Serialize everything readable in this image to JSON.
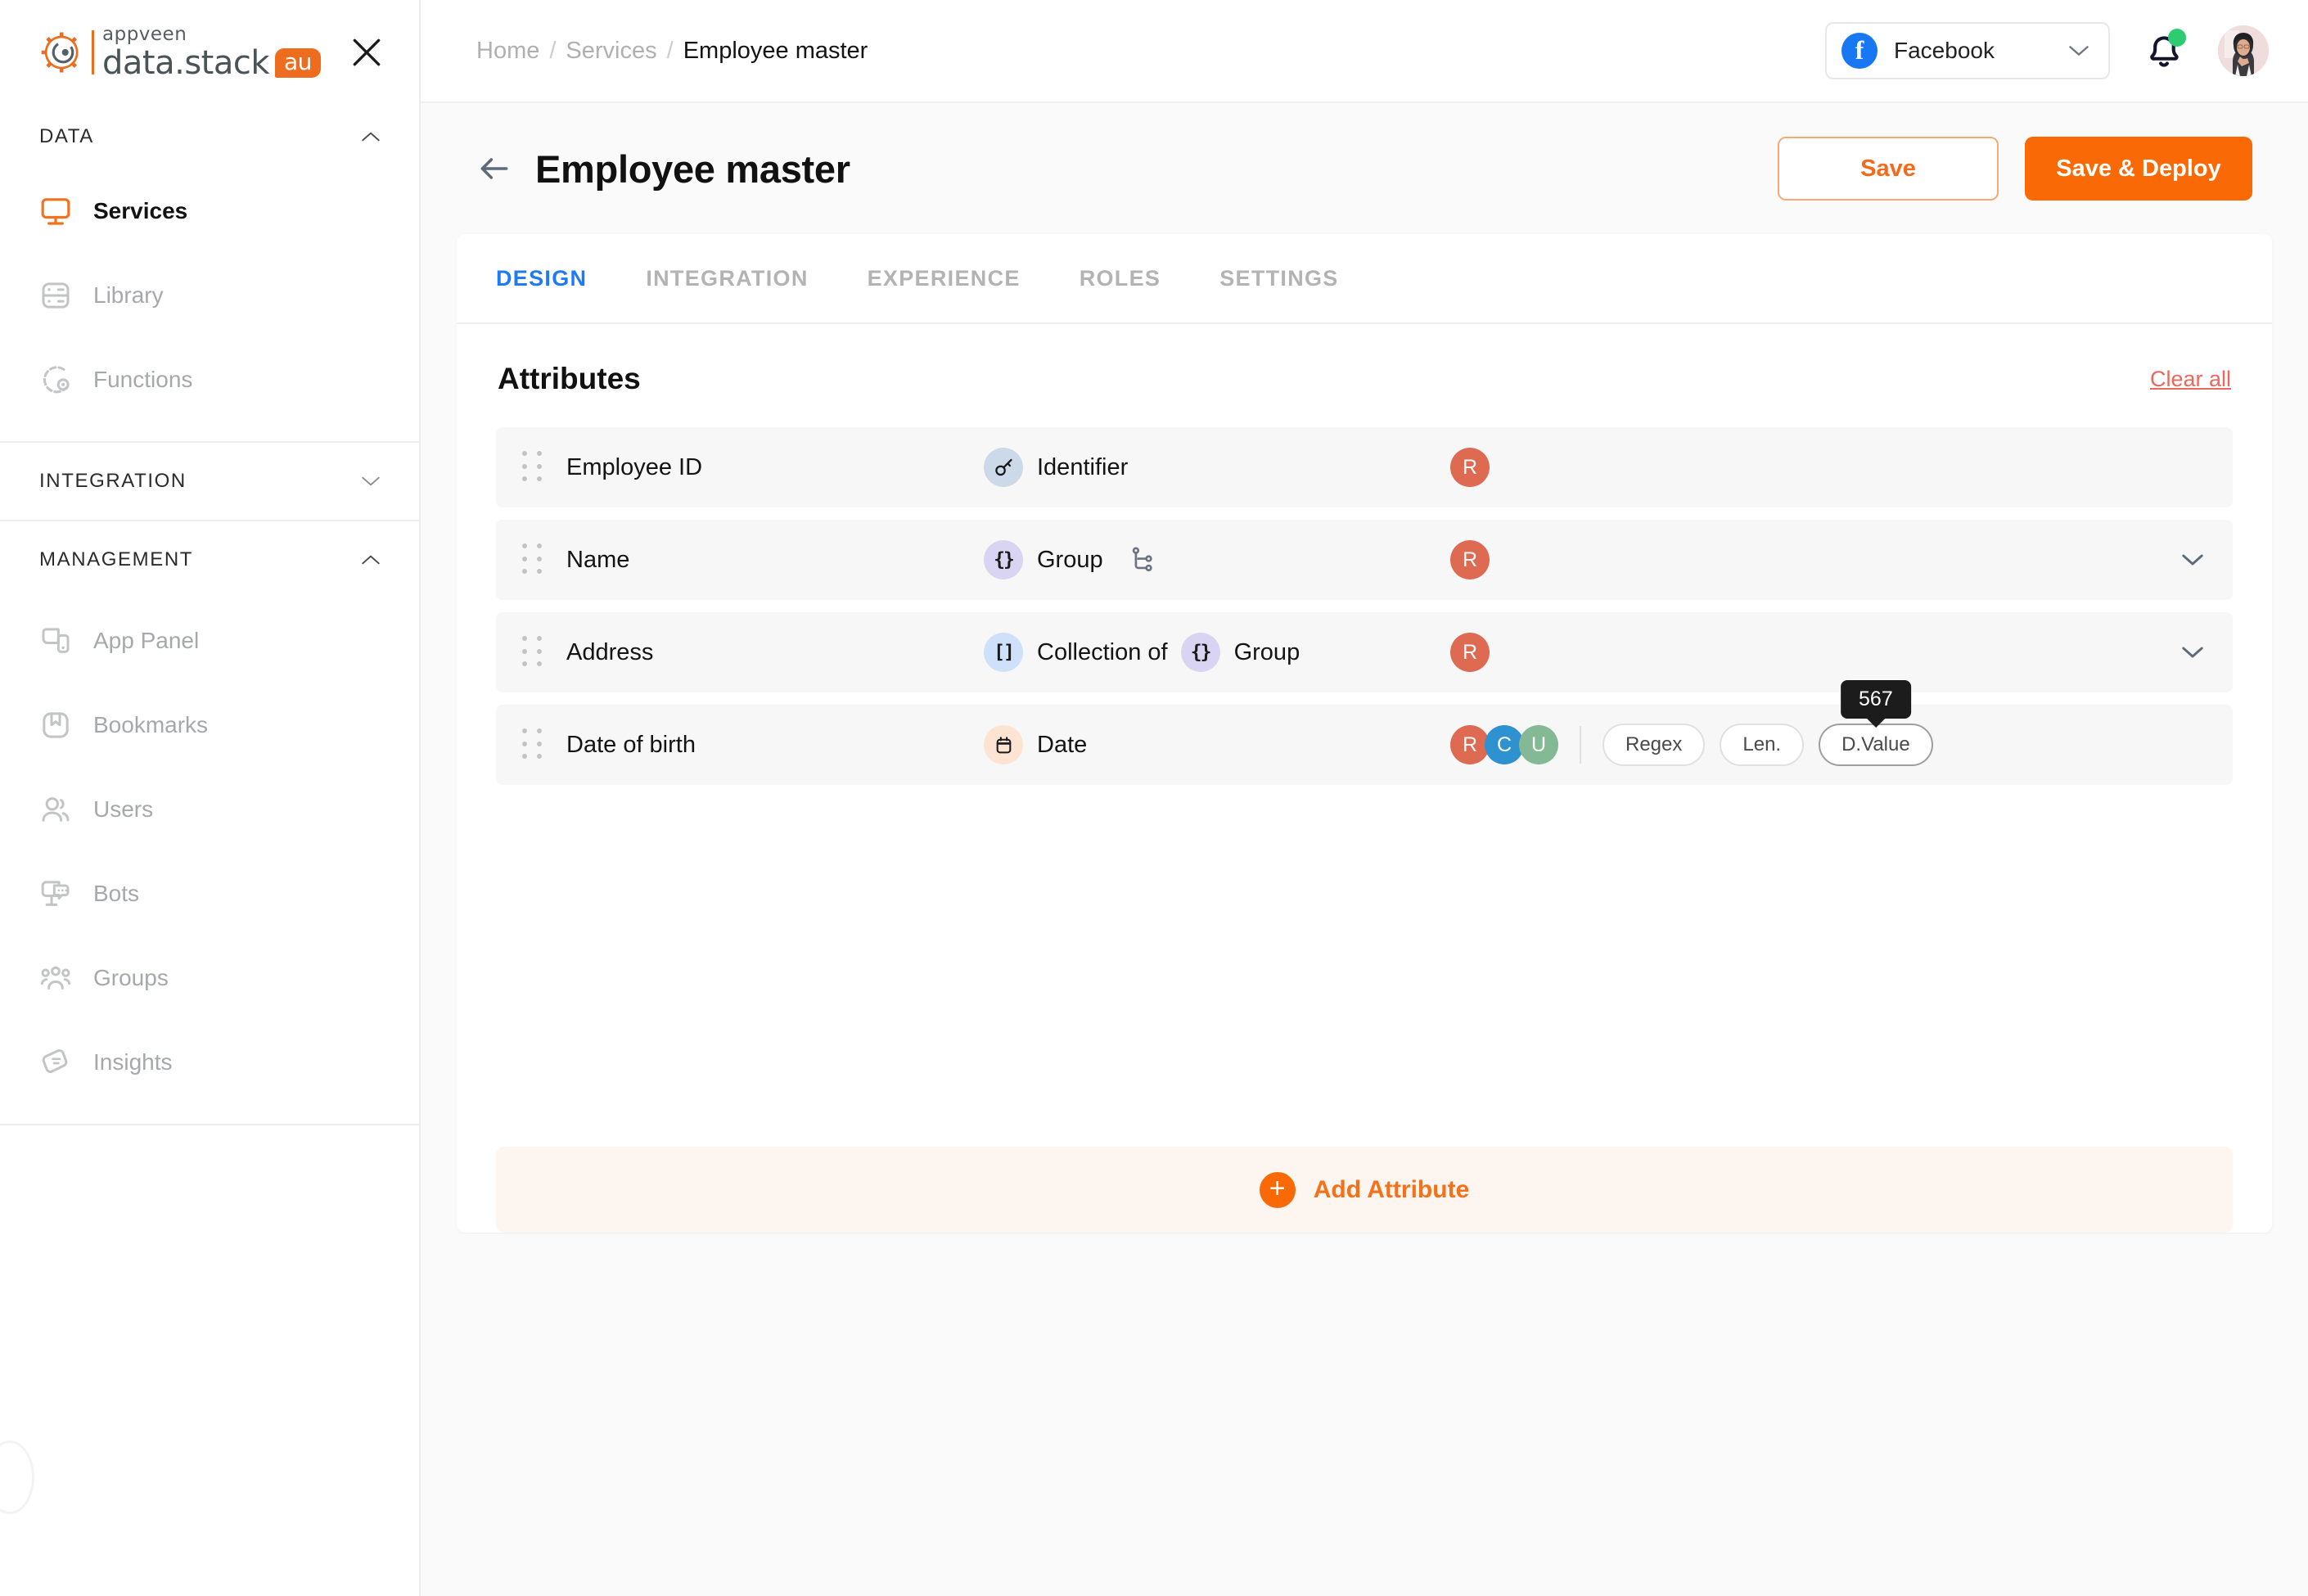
{
  "brand": {
    "appveen": "appveen",
    "product": "data.stack",
    "suffix": "au",
    "close_icon": "close-icon"
  },
  "sidebar": {
    "sections": [
      {
        "label": "DATA",
        "expanded": true,
        "chevron": "chevron-up-icon",
        "items": [
          {
            "label": "Services",
            "icon": "monitor-icon",
            "active": true
          },
          {
            "label": "Library",
            "icon": "library-icon",
            "active": false
          },
          {
            "label": "Functions",
            "icon": "chip-gear-icon",
            "active": false
          }
        ]
      },
      {
        "label": "INTEGRATION",
        "expanded": false,
        "chevron": "chevron-down-icon",
        "items": []
      },
      {
        "label": "MANAGEMENT",
        "expanded": true,
        "chevron": "chevron-up-icon",
        "items": [
          {
            "label": "App Panel",
            "icon": "app-panel-icon",
            "active": false
          },
          {
            "label": "Bookmarks",
            "icon": "bookmark-icon",
            "active": false
          },
          {
            "label": "Users",
            "icon": "users-icon",
            "active": false
          },
          {
            "label": "Bots",
            "icon": "bot-icon",
            "active": false
          },
          {
            "label": "Groups",
            "icon": "groups-icon",
            "active": false
          },
          {
            "label": "Insights",
            "icon": "insights-icon",
            "active": false
          }
        ]
      }
    ]
  },
  "topbar": {
    "breadcrumb": {
      "home": "Home",
      "services": "Services",
      "current": "Employee master",
      "separator": "/"
    },
    "app_selector": {
      "value": "Facebook",
      "icon": "facebook-icon",
      "chevron": "chevron-down-icon"
    },
    "notifications": {
      "icon": "bell-icon",
      "has_unread": true,
      "dot_color": "#2ECC71"
    },
    "avatar": {
      "icon": "avatar"
    }
  },
  "page": {
    "title": "Employee master",
    "back_icon": "arrow-left-icon",
    "save_label": "Save",
    "save_deploy_label": "Save & Deploy"
  },
  "tabs": [
    {
      "label": "DESIGN",
      "active": true
    },
    {
      "label": "INTEGRATION",
      "active": false
    },
    {
      "label": "EXPERIENCE",
      "active": false
    },
    {
      "label": "ROLES",
      "active": false
    },
    {
      "label": "SETTINGS",
      "active": false
    }
  ],
  "attributes_panel": {
    "title": "Attributes",
    "clear_all_label": "Clear all",
    "add_attribute_label": "Add Attribute",
    "add_attribute_icon": "plus-circle-icon",
    "rows": [
      {
        "name": "Employee ID",
        "types": [
          {
            "label": "Identifier",
            "glyph": "o‐",
            "style": "identifier"
          }
        ],
        "tree_icon": false,
        "flags": [
          {
            "letter": "R",
            "style": "r"
          }
        ],
        "pills": [],
        "expandable": false
      },
      {
        "name": "Name",
        "types": [
          {
            "label": "Group",
            "glyph": "{}",
            "style": "group"
          }
        ],
        "tree_icon": true,
        "flags": [
          {
            "letter": "R",
            "style": "r"
          }
        ],
        "pills": [],
        "expandable": true
      },
      {
        "name": "Address",
        "types": [
          {
            "label": "Collection of",
            "glyph": "[]",
            "style": "collection"
          },
          {
            "label": "Group",
            "glyph": "{}",
            "style": "group"
          }
        ],
        "tree_icon": false,
        "flags": [
          {
            "letter": "R",
            "style": "r"
          }
        ],
        "pills": [],
        "expandable": true
      },
      {
        "name": "Date of birth",
        "types": [
          {
            "label": "Date",
            "glyph": "cal",
            "style": "date"
          }
        ],
        "tree_icon": false,
        "flags": [
          {
            "letter": "R",
            "style": "r"
          },
          {
            "letter": "C",
            "style": "c"
          },
          {
            "letter": "U",
            "style": "u"
          }
        ],
        "pills": [
          {
            "label": "Regex",
            "focused": false,
            "tooltip": null
          },
          {
            "label": "Len.",
            "focused": false,
            "tooltip": null
          },
          {
            "label": "D.Value",
            "focused": true,
            "tooltip": "567"
          }
        ],
        "expandable": false
      }
    ]
  },
  "colors": {
    "accent": "#F96A06",
    "tab_active": "#1E7BF5",
    "clear_all": "#E9685F",
    "flag_r": "#DD6A51",
    "flag_c": "#2E91D0",
    "flag_u": "#84B995"
  }
}
